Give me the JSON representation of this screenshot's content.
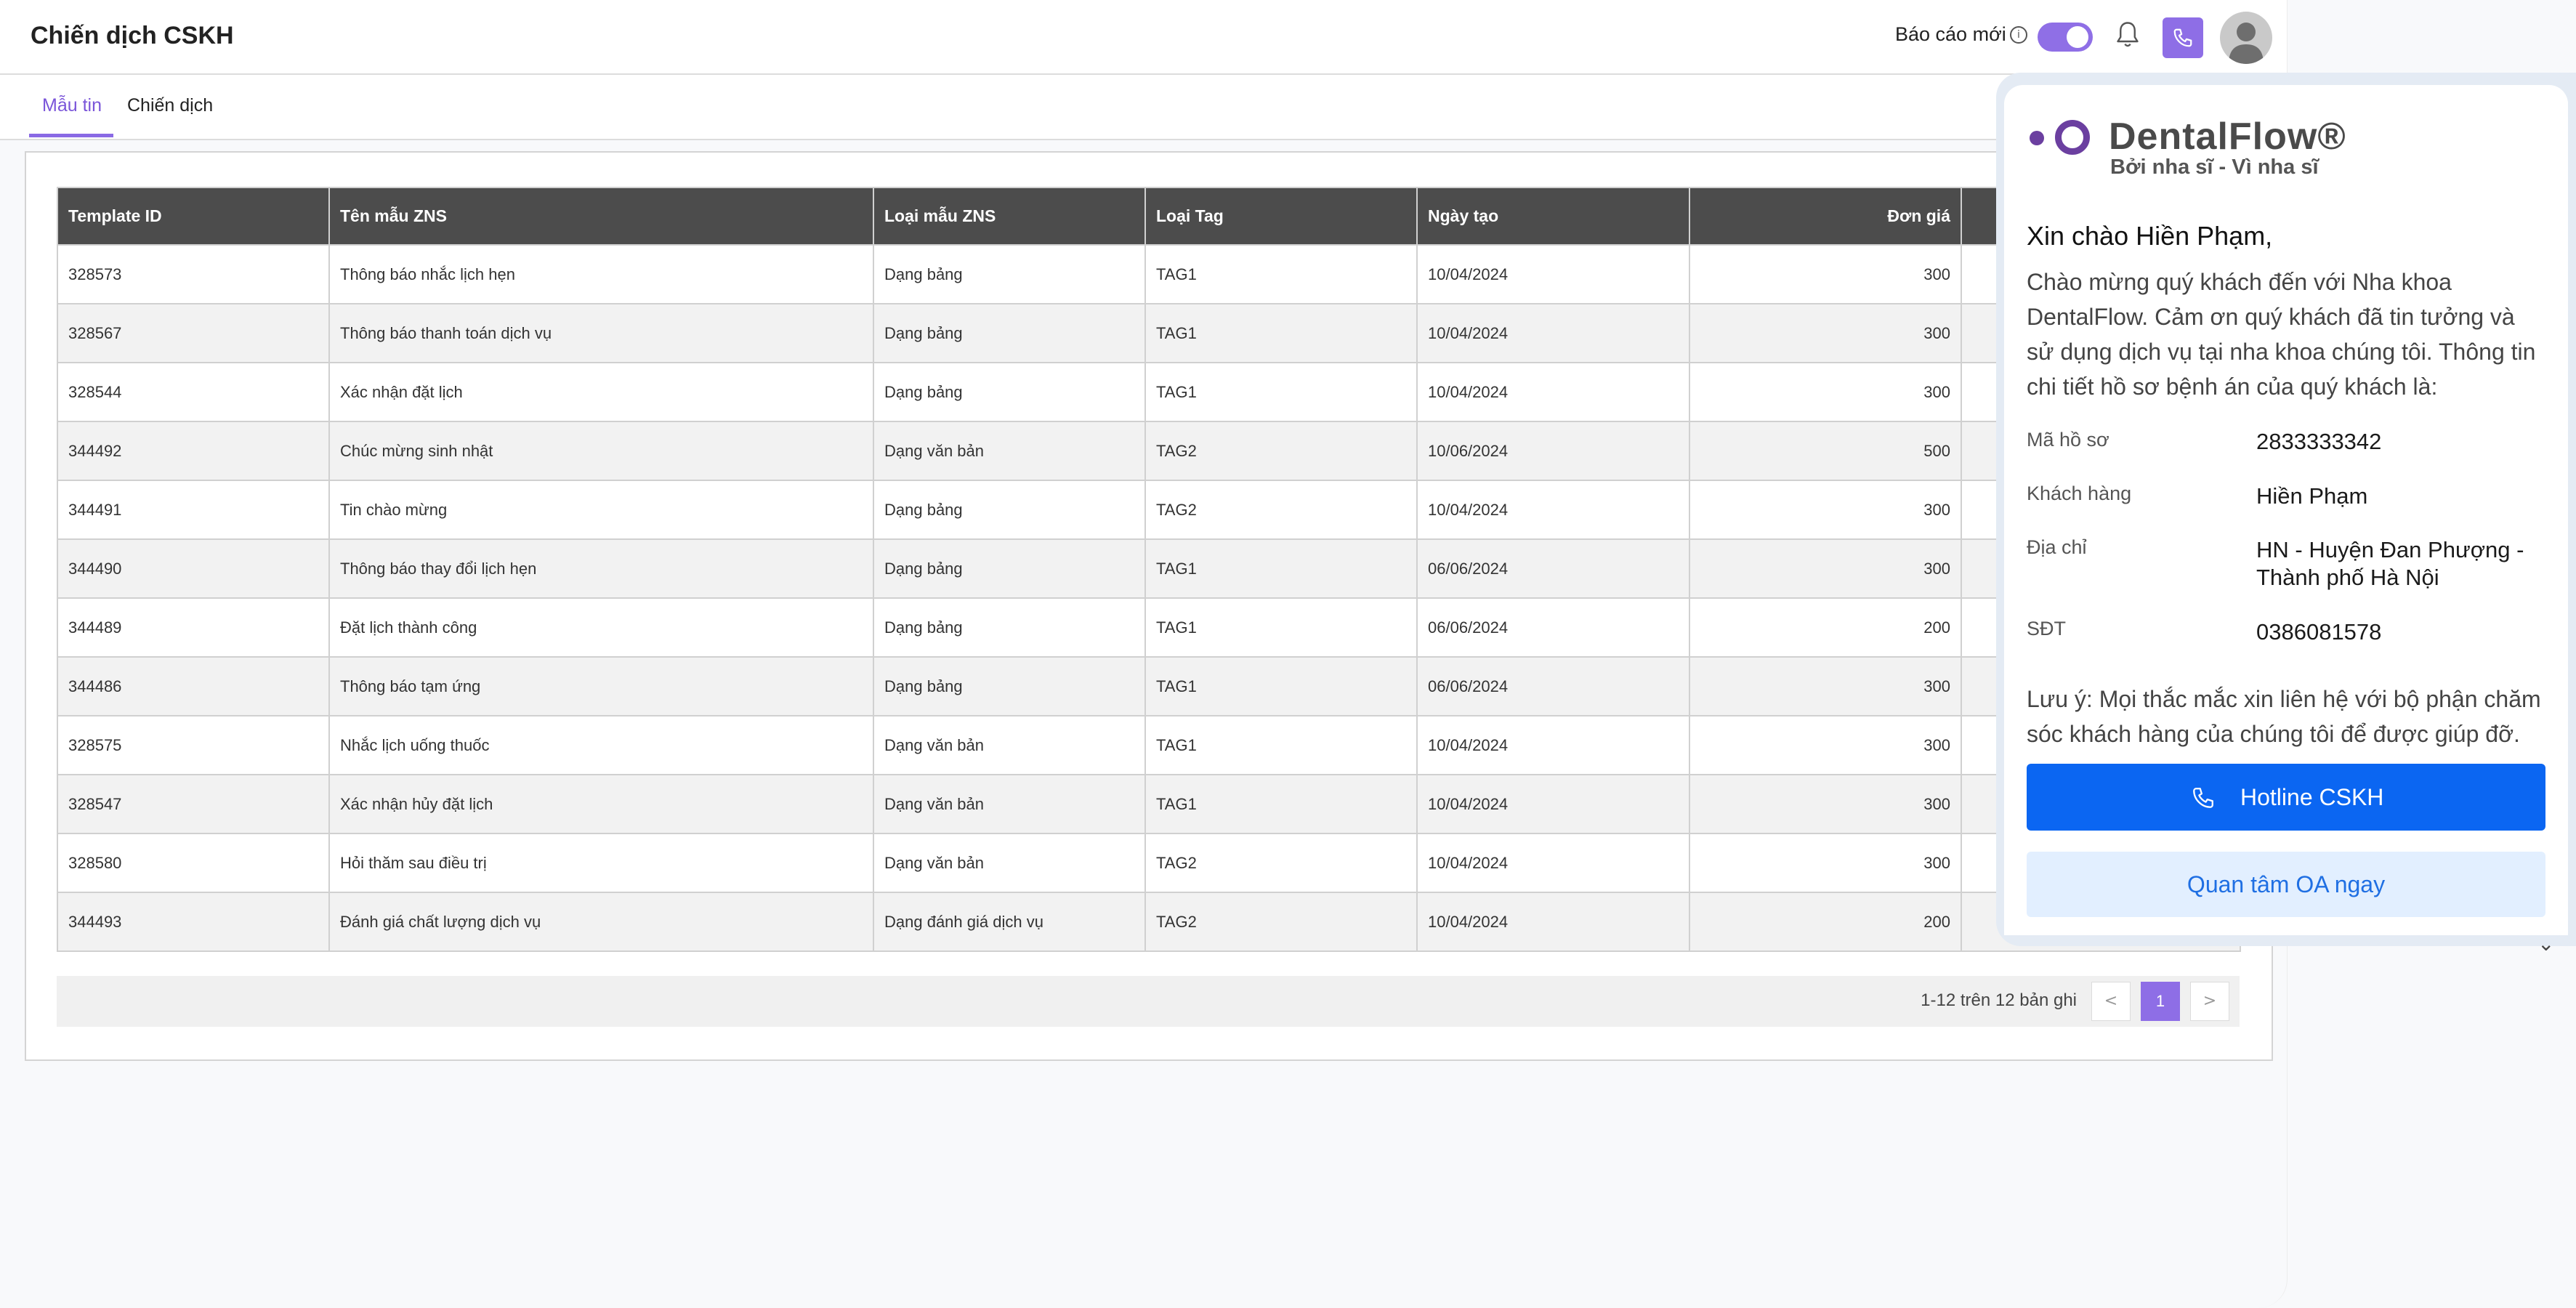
{
  "header": {
    "title": "Chiến dịch CSKH",
    "report_label": "Báo cáo mới",
    "info_glyph": "i",
    "report_toggle_on": true
  },
  "tabs": [
    {
      "label": "Mẫu tin",
      "active": true
    },
    {
      "label": "Chiến dịch",
      "active": false
    }
  ],
  "table": {
    "columns": [
      "Template ID",
      "Tên mẫu ZNS",
      "Loại mẫu ZNS",
      "Loại Tag",
      "Ngày tạo",
      "Đơn giá"
    ],
    "rows": [
      [
        "328573",
        "Thông báo nhắc lịch hẹn",
        "Dạng bảng",
        "TAG1",
        "10/04/2024",
        "300"
      ],
      [
        "328567",
        "Thông báo thanh toán dịch vụ",
        "Dạng bảng",
        "TAG1",
        "10/04/2024",
        "300"
      ],
      [
        "328544",
        "Xác nhận đặt lịch",
        "Dạng bảng",
        "TAG1",
        "10/04/2024",
        "300"
      ],
      [
        "344492",
        "Chúc mừng sinh nhật",
        "Dạng văn bản",
        "TAG2",
        "10/06/2024",
        "500"
      ],
      [
        "344491",
        "Tin chào mừng",
        "Dạng bảng",
        "TAG2",
        "10/04/2024",
        "300"
      ],
      [
        "344490",
        "Thông báo thay đổi lịch hẹn",
        "Dạng bảng",
        "TAG1",
        "06/06/2024",
        "300"
      ],
      [
        "344489",
        "Đặt lịch thành công",
        "Dạng bảng",
        "TAG1",
        "06/06/2024",
        "200"
      ],
      [
        "344486",
        "Thông báo tạm ứng",
        "Dạng bảng",
        "TAG1",
        "06/06/2024",
        "300"
      ],
      [
        "328575",
        "Nhắc lịch uống thuốc",
        "Dạng văn bản",
        "TAG1",
        "10/04/2024",
        "300"
      ],
      [
        "328547",
        "Xác nhận hủy đặt lịch",
        "Dạng văn bản",
        "TAG1",
        "10/04/2024",
        "300"
      ],
      [
        "328580",
        "Hỏi thăm sau điều trị",
        "Dạng văn bản",
        "TAG2",
        "10/04/2024",
        "300"
      ],
      [
        "344493",
        "Đánh giá chất lượng dịch vụ",
        "Dạng đánh giá dịch vụ",
        "TAG2",
        "10/04/2024",
        "200"
      ]
    ]
  },
  "pagination": {
    "info": "1-12 trên 12 bản ghi",
    "prev": "<",
    "current": "1",
    "next": ">"
  },
  "panel": {
    "brand": "DentalFlow®",
    "tagline": "Bởi nha sĩ - Vì nha sĩ",
    "greeting": "Xin chào Hiền Phạm,",
    "intro": "Chào mừng quý khách đến với Nha khoa DentalFlow. Cảm ơn quý khách đã tin tưởng và sử dụng dịch vụ tại nha khoa chúng tôi. Thông tin chi tiết hồ sơ bệnh án của quý khách là:",
    "fields": [
      {
        "label": "Mã hồ sơ",
        "value": "2833333342"
      },
      {
        "label": "Khách hàng",
        "value": "Hiền Phạm"
      },
      {
        "label": "Địa chỉ",
        "value": "HN - Huyện Đan Phượng - Thành phố Hà Nội"
      },
      {
        "label": "SĐT",
        "value": "0386081578"
      }
    ],
    "note": "Lưu ý: Mọi thắc mắc xin liên hệ với bộ phận chăm sóc khách hàng của chúng tôi để được giúp đỡ.",
    "hotline_label": "Hotline CSKH",
    "oa_label": "Quan tâm OA ngay",
    "collapse_glyph": "⌄"
  },
  "colors": {
    "accent": "#8e6ee6",
    "header_bg": "#4c4c4c",
    "hotline": "#0b66f2",
    "oa_bg": "#e2efff"
  }
}
